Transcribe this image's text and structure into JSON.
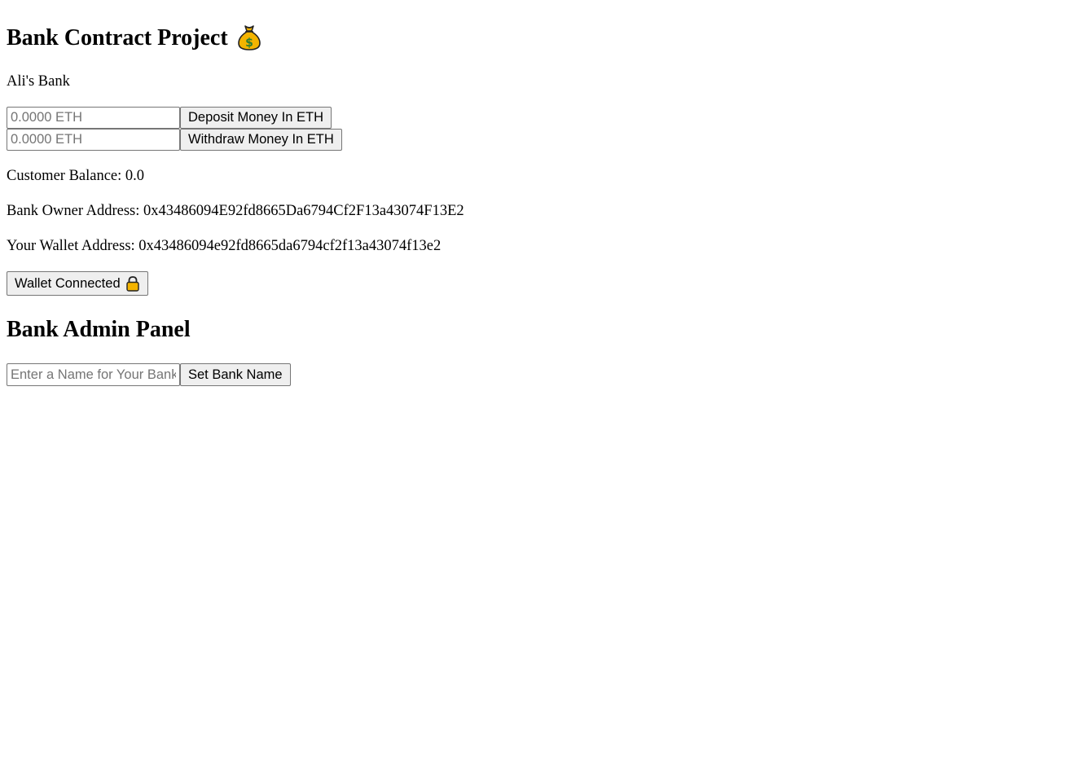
{
  "header": {
    "title": "Bank Contract Project"
  },
  "bank": {
    "name": "Ali's Bank"
  },
  "deposit": {
    "placeholder": "0.0000 ETH",
    "button_label": "Deposit Money In ETH"
  },
  "withdraw": {
    "placeholder": "0.0000 ETH",
    "button_label": "Withdraw Money In ETH"
  },
  "info": {
    "balance_text": "Customer Balance: 0.0",
    "owner_text": "Bank Owner Address: 0x43486094E92fd8665Da6794Cf2F13a43074F13E2",
    "wallet_text": "Your Wallet Address: 0x43486094e92fd8665da6794cf2f13a43074f13e2"
  },
  "wallet_button": {
    "label": "Wallet Connected"
  },
  "admin": {
    "title": "Bank Admin Panel",
    "name_placeholder": "Enter a Name for Your Bank",
    "set_button_label": "Set Bank Name"
  },
  "icons": {
    "title_icon": "money-bag-icon",
    "wallet_icon": "lock-icon"
  },
  "colors": {
    "button_bg": "#efefef",
    "border": "#767676",
    "placeholder": "#757575",
    "moneybag_gold": "#f4b400",
    "dollar_green": "#2e7d32"
  }
}
